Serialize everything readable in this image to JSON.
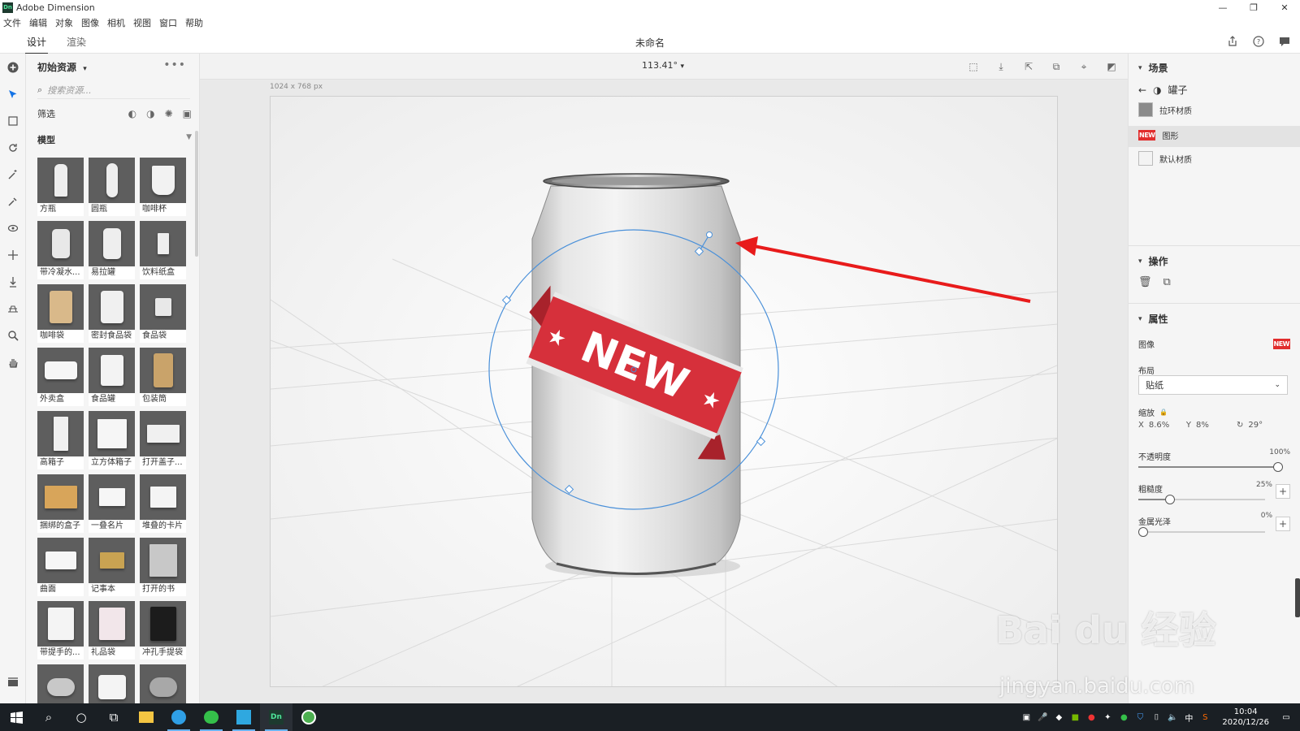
{
  "window": {
    "app_title": "Adobe Dimension",
    "app_icon_text": "Dn",
    "minimize": "—",
    "restore": "❐",
    "close": "✕"
  },
  "menu": [
    "文件",
    "编辑",
    "对象",
    "图像",
    "相机",
    "视图",
    "窗口",
    "帮助"
  ],
  "modes": {
    "design": "设计",
    "render": "渲染"
  },
  "document_title": "未命名",
  "assets": {
    "header": "初始资源",
    "search_placeholder": "搜索资源...",
    "filter_label": "筛选",
    "section": "模型",
    "items": [
      "方瓶",
      "圆瓶",
      "咖啡杯",
      "带冷凝水...",
      "易拉罐",
      "饮料纸盒",
      "咖啡袋",
      "密封食品袋",
      "食品袋",
      "外卖盒",
      "食品罐",
      "包装筒",
      "高箱子",
      "立方体箱子",
      "打开盖子...",
      "捆绑的盒子",
      "一叠名片",
      "堆叠的卡片",
      "曲面",
      "记事本",
      "打开的书",
      "带提手的...",
      "礼品袋",
      "冲孔手提袋",
      "",
      "",
      ""
    ]
  },
  "canvas": {
    "zoom": "113.41°",
    "size_label": "1024 x 768 px",
    "decal_text": "NEW"
  },
  "scene": {
    "title": "场景",
    "object_name": "罐子",
    "layers": [
      "拉环材质",
      "图形",
      "默认材质"
    ],
    "selected_index": 1
  },
  "actions": {
    "title": "操作"
  },
  "properties": {
    "title": "属性",
    "image_label": "图像",
    "image_badge": "NEW",
    "layout_label": "布局",
    "layout_value": "贴纸",
    "scale_label": "缩放",
    "x_label": "X",
    "x_value": "8.6%",
    "y_label": "Y",
    "y_value": "8%",
    "rotation_value": "29°",
    "opacity_label": "不透明度",
    "opacity_value": "100%",
    "opacity_level": 1.0,
    "roughness_label": "粗糙度",
    "roughness_value": "25%",
    "roughness_level": 0.25,
    "metallic_label": "金属光泽",
    "metallic_value": "0%",
    "metallic_level": 0.0
  },
  "taskbar": {
    "clock_time": "10:04",
    "clock_date": "2020/12/26",
    "ime": "中"
  },
  "watermark": {
    "line1": "Bai du 经验",
    "line2": "jingyan.baidu.com"
  },
  "colors": {
    "accent": "#1473e6",
    "arrow": "#e81b1b",
    "badge": "#e12d2d",
    "selection_ring": "#4a90d9"
  }
}
